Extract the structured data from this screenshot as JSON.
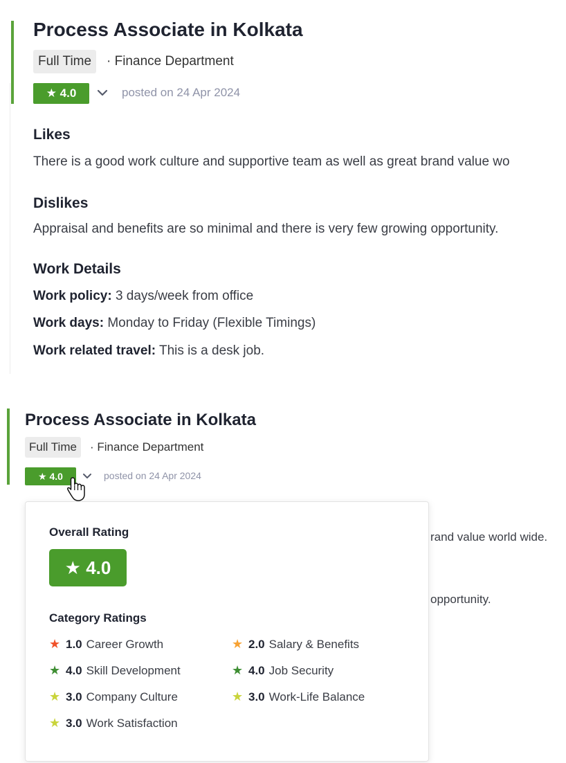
{
  "review": {
    "title": "Process Associate in Kolkata",
    "employment_type": "Full Time",
    "department": "· Finance Department",
    "rating_badge": "★ 4.0",
    "posted": "posted on 24 Apr 2024",
    "likes_heading": "Likes",
    "likes_text": "There is a good work culture and supportive team as well as great brand value wo",
    "dislikes_heading": "Dislikes",
    "dislikes_text": "Appraisal and benefits are so minimal and there is very few growing opportunity.",
    "work_details_heading": "Work Details",
    "work_policy_label": "Work policy:",
    "work_policy_value": "3 days/week from office",
    "work_days_label": "Work days:",
    "work_days_value": "Monday to Friday (Flexible Timings)",
    "travel_label": "Work related travel:",
    "travel_value": "This is a desk job."
  },
  "hover_state": {
    "title": "Process Associate in Kolkata",
    "employment_type": "Full Time",
    "department": "· Finance Department",
    "rating_badge": "★ 4.0",
    "posted": "posted on 24 Apr 2024",
    "behind_line_1": "rand value world wide.",
    "behind_line_2": "opportunity."
  },
  "popover": {
    "overall_heading": "Overall Rating",
    "overall_value": "★ 4.0",
    "category_heading": "Category Ratings",
    "categories": [
      {
        "value": "1.0",
        "label": "Career Growth",
        "color": "#f0522a"
      },
      {
        "value": "2.0",
        "label": "Salary & Benefits",
        "color": "#f7a233"
      },
      {
        "value": "4.0",
        "label": "Skill Development",
        "color": "#3e8e33"
      },
      {
        "value": "4.0",
        "label": "Job Security",
        "color": "#3e8e33"
      },
      {
        "value": "3.0",
        "label": "Company Culture",
        "color": "#c9d43b"
      },
      {
        "value": "3.0",
        "label": "Work-Life Balance",
        "color": "#c9d43b"
      },
      {
        "value": "3.0",
        "label": "Work Satisfaction",
        "color": "#c9d43b"
      }
    ]
  },
  "colors": {
    "accent": "#5aa33a",
    "badge": "#4a9c2c",
    "muted": "#8f93a8"
  },
  "icons": {
    "star": "star-icon",
    "chevron": "chevron-down-icon",
    "cursor": "hand-pointer-cursor-icon"
  }
}
